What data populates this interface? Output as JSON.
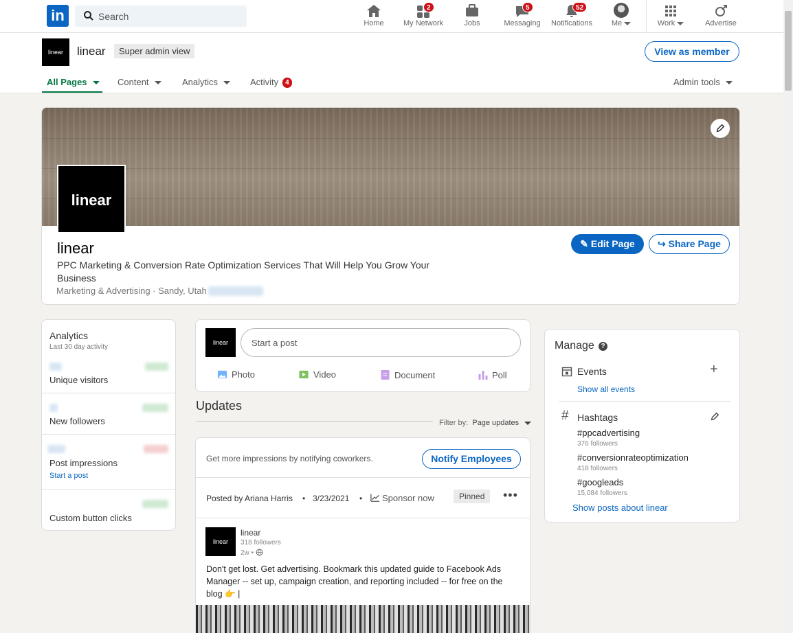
{
  "nav": {
    "logo_text": "in",
    "search_placeholder": "Search",
    "items": [
      {
        "label": "Home"
      },
      {
        "label": "My Network",
        "badge": "2"
      },
      {
        "label": "Jobs"
      },
      {
        "label": "Messaging",
        "badge": "5"
      },
      {
        "label": "Notifications",
        "badge": "52"
      },
      {
        "label": "Me"
      },
      {
        "label": "Work"
      },
      {
        "label": "Advertise"
      }
    ]
  },
  "admin": {
    "logo_text": "linear",
    "page_name": "linear",
    "view_badge": "Super admin view",
    "view_as_member": "View as member",
    "tabs": [
      {
        "label": "All Pages"
      },
      {
        "label": "Content"
      },
      {
        "label": "Analytics"
      },
      {
        "label": "Activity",
        "badge": "4"
      }
    ],
    "admin_tools": "Admin tools"
  },
  "profile": {
    "logo_text": "linear",
    "name": "linear",
    "tagline_1": "PPC Marketing & Conversion Rate Optimization Services That Will Help You Grow Your",
    "tagline_2": "Business",
    "meta": "Marketing & Advertising · Sandy, Utah",
    "edit_page": "Edit Page",
    "share_page": "Share Page"
  },
  "analytics": {
    "title": "Analytics",
    "subtitle": "Last 30 day activity",
    "metrics": [
      {
        "label": "Unique visitors"
      },
      {
        "label": "New followers"
      },
      {
        "label": "Post impressions",
        "link": "Start a post"
      },
      {
        "label": "Custom button clicks"
      }
    ]
  },
  "composer": {
    "logo_text": "linear",
    "placeholder": "Start a post",
    "actions": [
      {
        "label": "Photo"
      },
      {
        "label": "Video"
      },
      {
        "label": "Document"
      },
      {
        "label": "Poll"
      }
    ]
  },
  "updates": {
    "title": "Updates",
    "filter_label": "Filter by:",
    "filter_value": "Page updates",
    "notify_text": "Get more impressions by notifying coworkers.",
    "notify_button": "Notify Employees"
  },
  "post": {
    "posted_by": "Posted by Ariana Harris",
    "date": "3/23/2021",
    "sponsor": "Sponsor now",
    "pinned": "Pinned",
    "logo_text": "linear",
    "author": "linear",
    "followers": "318 followers",
    "age": "2w •",
    "body_1": "Don't get lost. Get advertising. Bookmark this updated guide to Facebook Ads",
    "body_2": "Manager -- set up, campaign creation, and reporting included -- for free on the",
    "body_3": "blog 👉 |"
  },
  "manage": {
    "title": "Manage",
    "events_label": "Events",
    "show_all_events": "Show all events",
    "hashtags_label": "Hashtags",
    "hashtags": [
      {
        "tag": "#ppcadvertising",
        "followers": "376 followers"
      },
      {
        "tag": "#conversionrateoptimization",
        "followers": "418 followers"
      },
      {
        "tag": "#googleads",
        "followers": "15,084 followers"
      }
    ],
    "show_posts": "Show posts about linear"
  },
  "colors": {
    "accent": "#0a66c2",
    "badge": "#cc1016",
    "active_tab": "#057642"
  }
}
